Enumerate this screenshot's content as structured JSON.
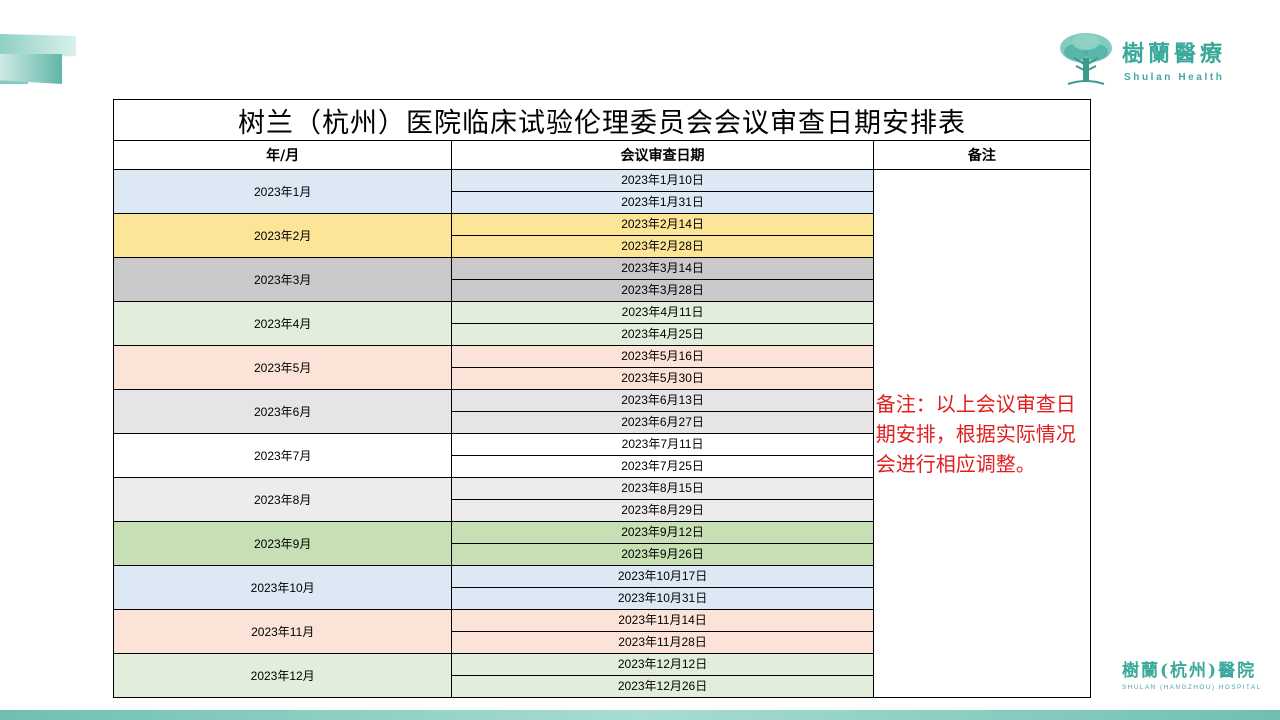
{
  "brand": {
    "name_cn": "樹蘭醫療",
    "name_en": "Shulan Health",
    "hospital_cn": "樹蘭(杭州)醫院",
    "hospital_en": "SHULAN (HANGZHOU) HOSPITAL",
    "accent_color": "#3aa89a"
  },
  "table": {
    "title": "树兰（杭州）医院临床试验伦理委员会会议审查日期安排表",
    "headers": {
      "month": "年/月",
      "date": "会议审查日期",
      "note": "备注"
    },
    "note": "备注：以上会议审查日期安排，根据实际情况会进行相应调整。",
    "note_color": "#e02020",
    "rows": [
      {
        "month": "2023年1月",
        "dates": [
          "2023年1月10日",
          "2023年1月31日"
        ],
        "color": "#dce9f5"
      },
      {
        "month": "2023年2月",
        "dates": [
          "2023年2月14日",
          "2023年2月28日"
        ],
        "color": "#fde597"
      },
      {
        "month": "2023年3月",
        "dates": [
          "2023年3月14日",
          "2023年3月28日"
        ],
        "color": "#c9c9c9"
      },
      {
        "month": "2023年4月",
        "dates": [
          "2023年4月11日",
          "2023年4月25日"
        ],
        "color": "#e2eedb"
      },
      {
        "month": "2023年5月",
        "dates": [
          "2023年5月16日",
          "2023年5月30日"
        ],
        "color": "#fbe3d7"
      },
      {
        "month": "2023年6月",
        "dates": [
          "2023年6月13日",
          "2023年6月27日"
        ],
        "color": "#e6e4e6"
      },
      {
        "month": "2023年7月",
        "dates": [
          "2023年7月11日",
          "2023年7月25日"
        ],
        "color": "#ffffff"
      },
      {
        "month": "2023年8月",
        "dates": [
          "2023年8月15日",
          "2023年8月29日"
        ],
        "color": "#ececec"
      },
      {
        "month": "2023年9月",
        "dates": [
          "2023年9月12日",
          "2023年9月26日"
        ],
        "color": "#c6dfb4"
      },
      {
        "month": "2023年10月",
        "dates": [
          "2023年10月17日",
          "2023年10月31日"
        ],
        "color": "#dce9f5"
      },
      {
        "month": "2023年11月",
        "dates": [
          "2023年11月14日",
          "2023年11月28日"
        ],
        "color": "#fbe3d7"
      },
      {
        "month": "2023年12月",
        "dates": [
          "2023年12月12日",
          "2023年12月26日"
        ],
        "color": "#e2eedb"
      }
    ]
  }
}
